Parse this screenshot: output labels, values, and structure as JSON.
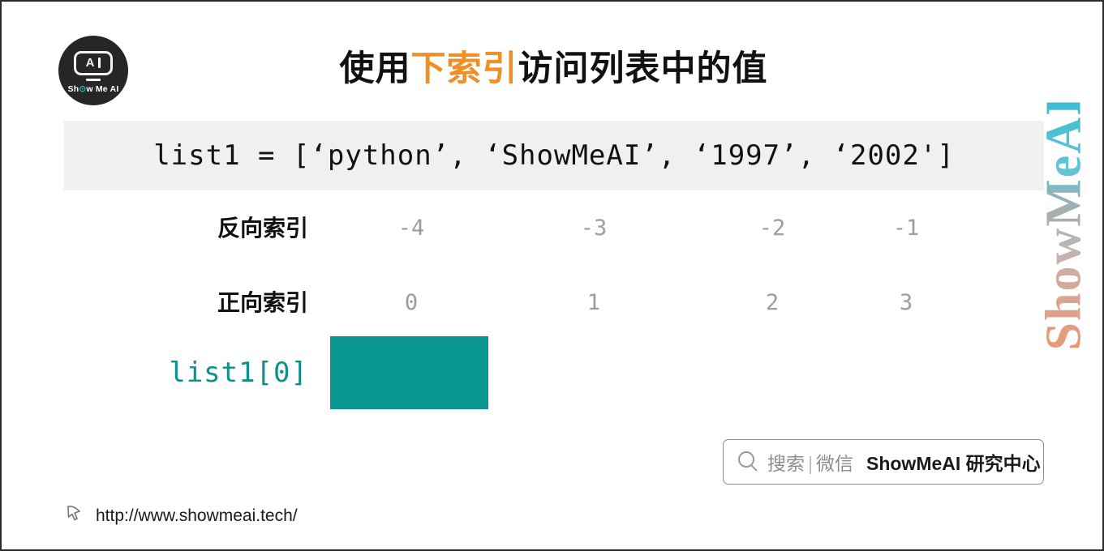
{
  "logo": {
    "name": "show-me-ai-logo",
    "screen_letter": "A",
    "brand_prefix": "Sh",
    "brand_dot": "⊙",
    "brand_suffix": "w Me AI"
  },
  "title": {
    "before": "使用",
    "highlight": "下索引",
    "after": "访问列表中的值",
    "highlight_color": "#ef8f26"
  },
  "code": {
    "line": "list1 = [‘python’, ‘ShowMeAI’, ‘1997’, ‘2002']"
  },
  "rows": [
    {
      "label": "反向索引",
      "values": [
        "-4",
        "-3",
        "-2",
        "-1"
      ]
    },
    {
      "label": "正向索引",
      "values": [
        "0",
        "1",
        "2",
        "3"
      ]
    }
  ],
  "expression": {
    "label": "list1[0]",
    "label_color": "#0d8f8c",
    "answer_box_color": "#099693",
    "answer_text": ""
  },
  "watermark": {
    "text": "ShowMeAI"
  },
  "search_badge": {
    "icon": "search-icon",
    "soft_text": "搜索",
    "separator": "|",
    "channel": "微信",
    "strong_text": "ShowMeAI 研究中心"
  },
  "footer": {
    "icon": "cursor-icon",
    "url": "http://www.showmeai.tech/"
  }
}
